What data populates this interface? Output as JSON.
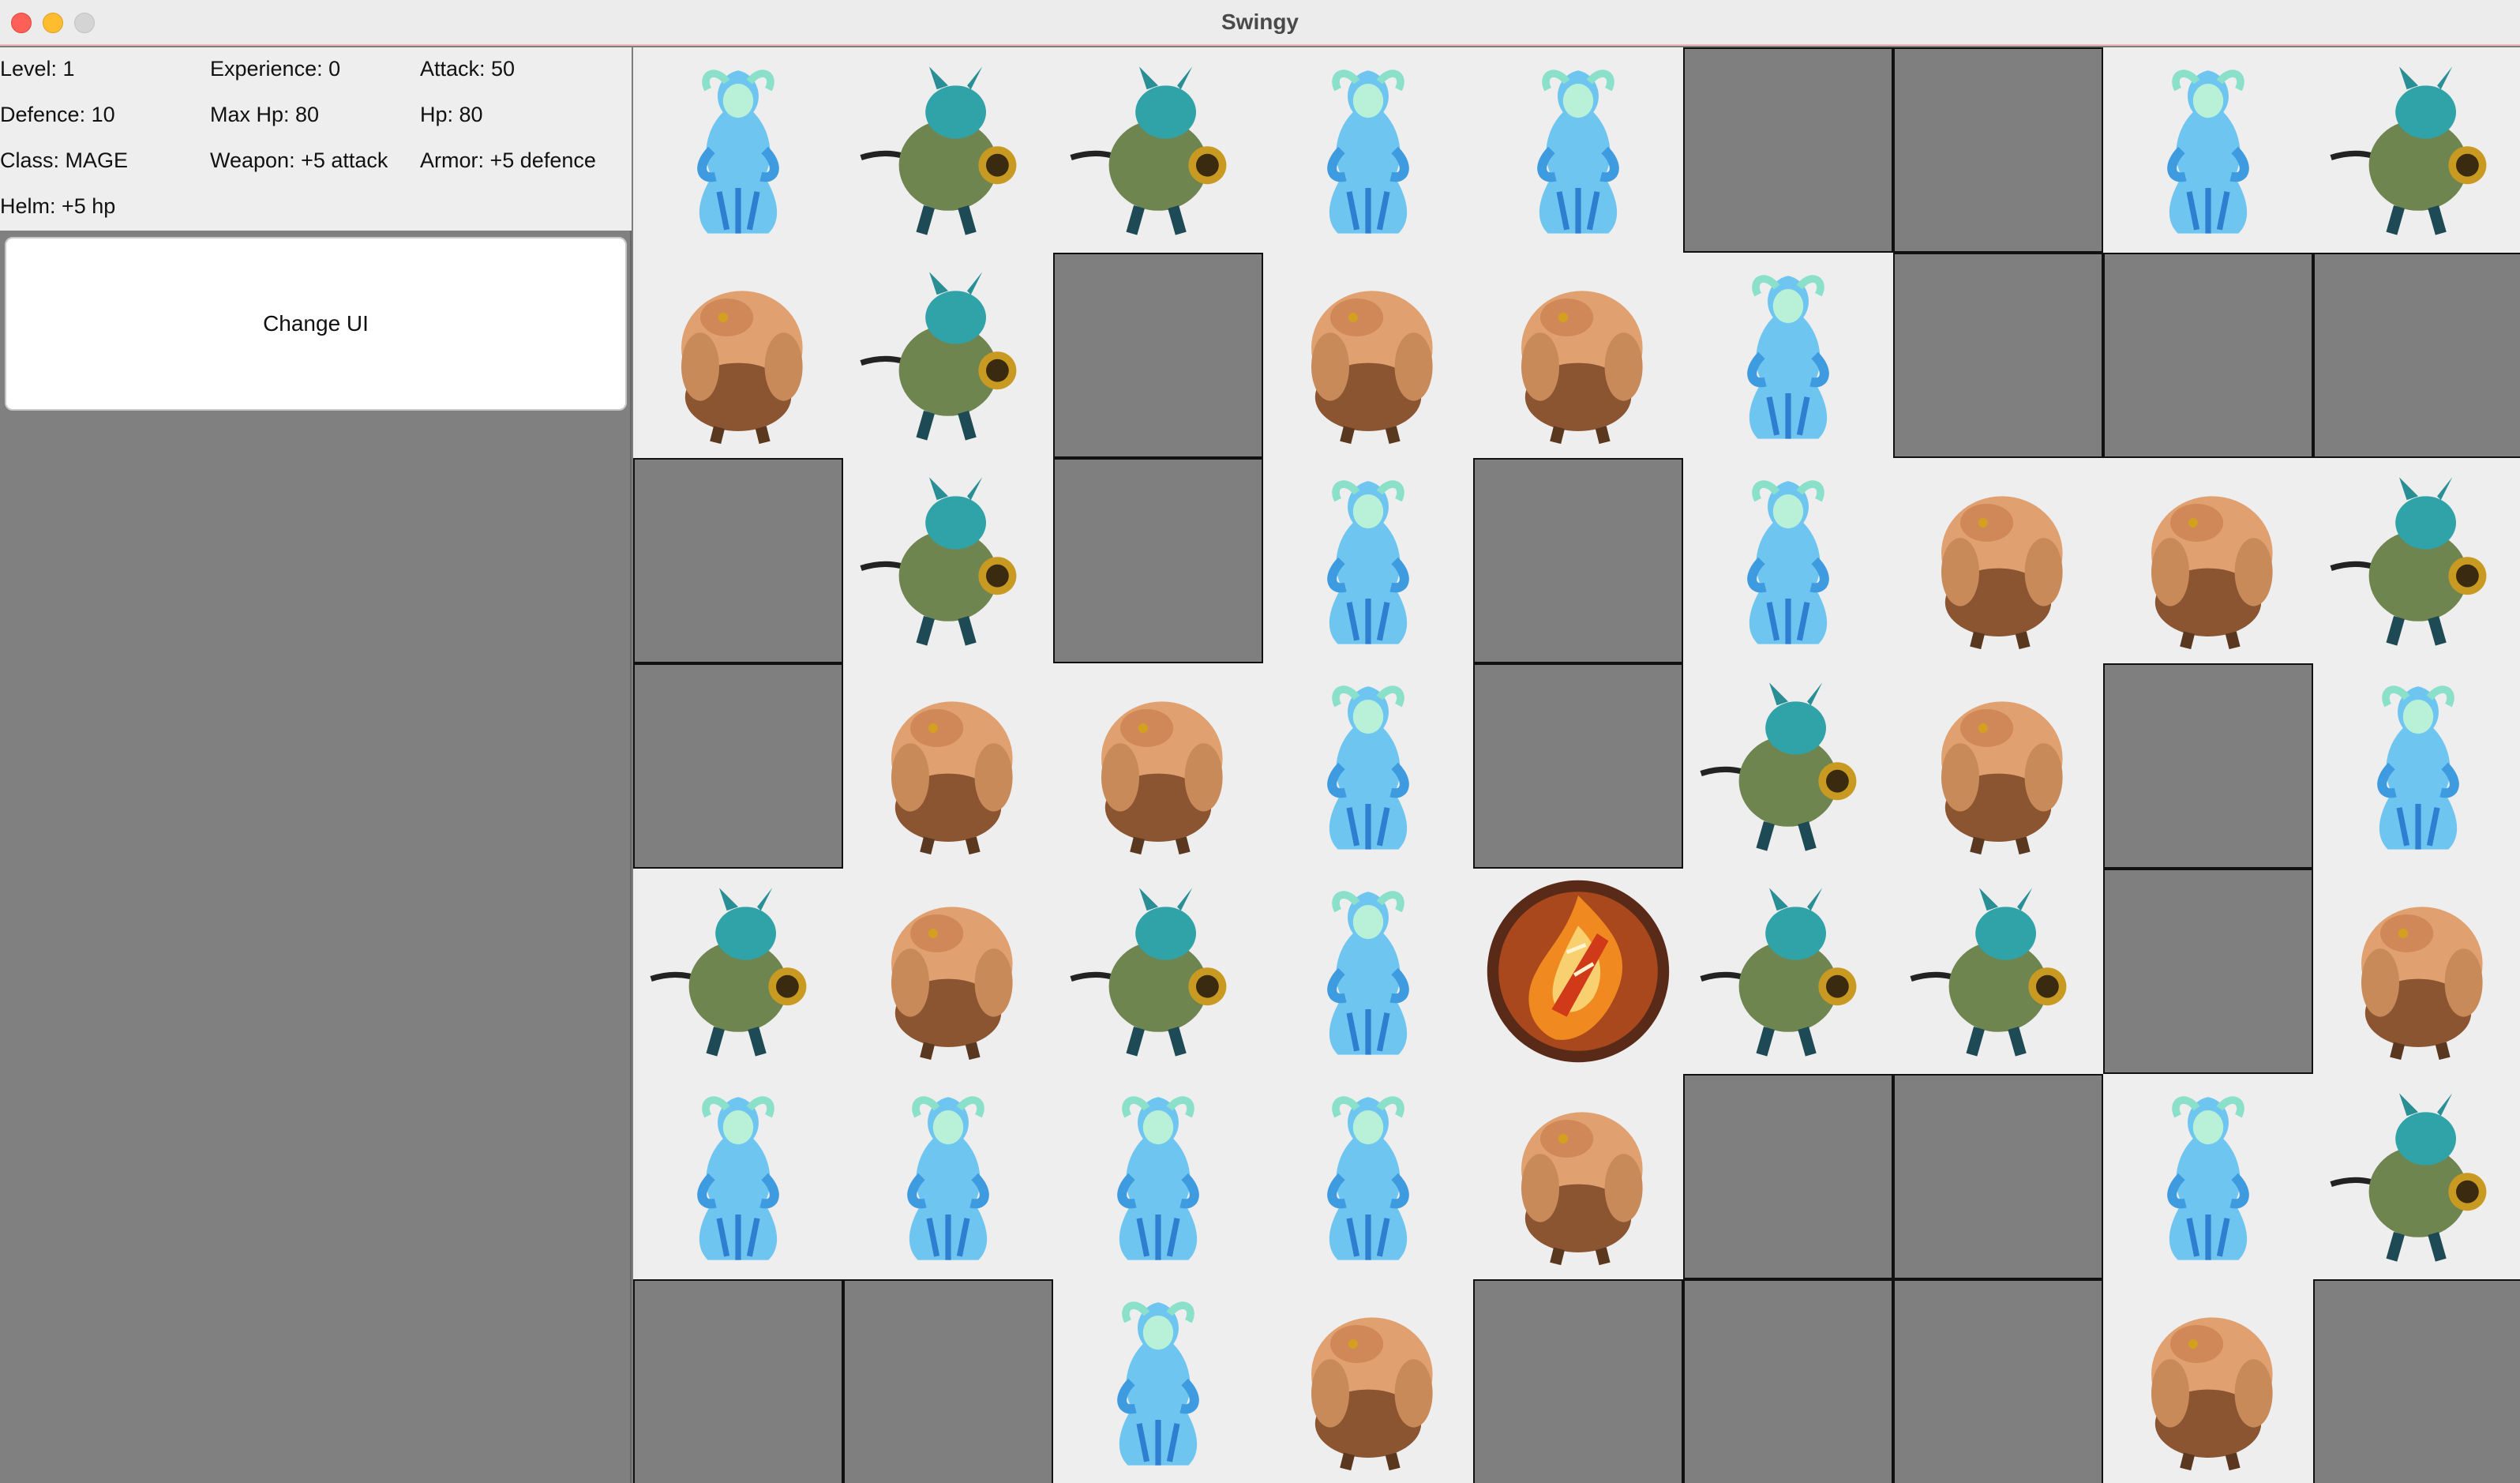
{
  "window": {
    "title": "Swingy"
  },
  "stats": {
    "level": "Level: 1",
    "experience": "Experience: 0",
    "attack": "Attack: 50",
    "defence": "Defence: 10",
    "max_hp": "Max Hp: 80",
    "hp": "Hp: 80",
    "class": "Class: MAGE",
    "weapon": "Weapon: +5 attack",
    "armor": "Armor: +5 defence",
    "helm": "Helm: +5 hp"
  },
  "buttons": {
    "change_ui": "Change UI"
  },
  "colors": {
    "wall": "#7f7f7f",
    "floor": "#eeeeee",
    "sidebar": "#808080"
  },
  "map": {
    "legend": {
      "W": "wall",
      "S": "ice-spirit",
      "G": "goblin-rat",
      "B": "brute",
      "H": "hero-fire-emblem"
    },
    "rows": [
      [
        "S",
        "G",
        "G",
        "S",
        "S",
        "W",
        "W",
        "S",
        "G"
      ],
      [
        "B",
        "G",
        "W",
        "B",
        "B",
        "S",
        "W",
        "W",
        "W"
      ],
      [
        "W",
        "G",
        "W",
        "S",
        "W",
        "S",
        "B",
        "B",
        "G"
      ],
      [
        "W",
        "B",
        "B",
        "S",
        "W",
        "G",
        "B",
        "W",
        "S"
      ],
      [
        "G",
        "B",
        "G",
        "S",
        "H",
        "G",
        "G",
        "W",
        "B"
      ],
      [
        "S",
        "S",
        "S",
        "S",
        "B",
        "W",
        "W",
        "S",
        "G"
      ],
      [
        "W",
        "W",
        "S",
        "B",
        "W",
        "W",
        "W",
        "B",
        "W"
      ]
    ]
  }
}
